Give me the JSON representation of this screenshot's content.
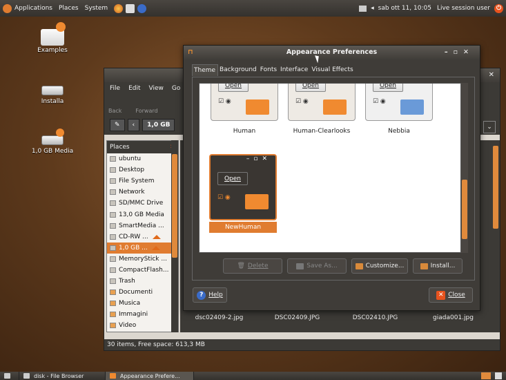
{
  "top_panel": {
    "menus": [
      "Applications",
      "Places",
      "System"
    ],
    "clock": "sab ott 11, 10:05",
    "user": "Live session user"
  },
  "desktop_icons": [
    {
      "label": "Examples",
      "icon": "folder-icon"
    },
    {
      "label": "Installa",
      "icon": "drive-icon"
    },
    {
      "label": "1,0 GB Media",
      "icon": "usb-drive-icon"
    }
  ],
  "file_browser": {
    "menus": [
      "File",
      "Edit",
      "View",
      "Go"
    ],
    "toolbar": [
      "Back",
      "Forward"
    ],
    "location": "1,0 GB",
    "places_header": "Places",
    "places": [
      {
        "label": "ubuntu",
        "selected": false
      },
      {
        "label": "Desktop",
        "selected": false
      },
      {
        "label": "File System",
        "selected": false
      },
      {
        "label": "Network",
        "selected": false
      },
      {
        "label": "SD/MMC Drive",
        "selected": false
      },
      {
        "label": "13,0 GB Media",
        "selected": false
      },
      {
        "label": "SmartMedia ...",
        "selected": false
      },
      {
        "label": "CD-RW ...",
        "selected": false,
        "eject": true
      },
      {
        "label": "1,0 GB ...",
        "selected": true,
        "eject": true
      },
      {
        "label": "MemoryStick ...",
        "selected": false
      },
      {
        "label": "CompactFlash...",
        "selected": false
      },
      {
        "label": "Trash",
        "selected": false
      },
      {
        "label": "Documenti",
        "selected": false
      },
      {
        "label": "Musica",
        "selected": false
      },
      {
        "label": "Immagini",
        "selected": false
      },
      {
        "label": "Video",
        "selected": false
      }
    ],
    "files": [
      "dsc02409-2.jpg",
      "DSC02409.JPG",
      "DSC02410.JPG",
      "giada001.jpg"
    ],
    "status": "30 items, Free space: 613,3 MB"
  },
  "appearance": {
    "title": "Appearance Preferences",
    "tabs": [
      "Theme",
      "Background",
      "Fonts",
      "Interface",
      "Visual Effects"
    ],
    "active_tab": "Theme",
    "themes": [
      {
        "name": "Human",
        "open": "Open",
        "bg": "#eeeae4",
        "folder": "#f08a30"
      },
      {
        "name": "Human-Clearlooks",
        "open": "Open",
        "bg": "#eeeae4",
        "folder": "#f08a30"
      },
      {
        "name": "Nebbia",
        "open": "Open",
        "bg": "#f0f0f0",
        "folder": "#6a9ad8"
      },
      {
        "name": "NewHuman",
        "open": "Open",
        "bg": "#3a3632",
        "folder": "#f08a30",
        "selected": true
      }
    ],
    "buttons": {
      "delete": "Delete",
      "save_as": "Save As...",
      "customize": "Customize...",
      "install": "Install...",
      "help": "Help",
      "close": "Close"
    }
  },
  "taskbar": {
    "tasks": [
      "disk - File Browser",
      "Appearance Prefere..."
    ]
  },
  "colors": {
    "accent": "#e07c30",
    "panel": "#3c3a36"
  }
}
